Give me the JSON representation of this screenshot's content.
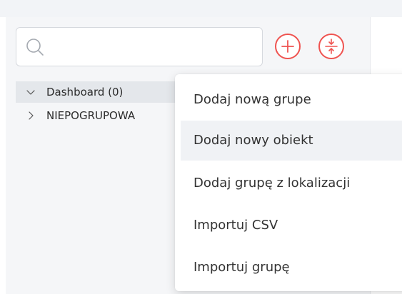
{
  "search": {
    "value": "",
    "placeholder": ""
  },
  "toolbar": {
    "add_icon": "plus-circle-icon",
    "collapse_icon": "collapse-arrows-icon"
  },
  "tree": {
    "items": [
      {
        "label": "Dashboard (0)",
        "expanded": true,
        "icon": "chevron-down-icon"
      },
      {
        "label": "NIEPOGRUPOWA",
        "expanded": false,
        "icon": "chevron-right-icon"
      }
    ]
  },
  "menu": {
    "items": [
      {
        "label": "Dodaj nową grupe"
      },
      {
        "label": "Dodaj nowy obiekt"
      },
      {
        "label": "Dodaj grupę z lokalizacji"
      },
      {
        "label": "Importuj CSV"
      },
      {
        "label": "Importuj grupę"
      }
    ]
  },
  "colors": {
    "accent": "#ef5350",
    "selected_row": "#e4e7eb",
    "hover_row": "#f0f2f5"
  }
}
